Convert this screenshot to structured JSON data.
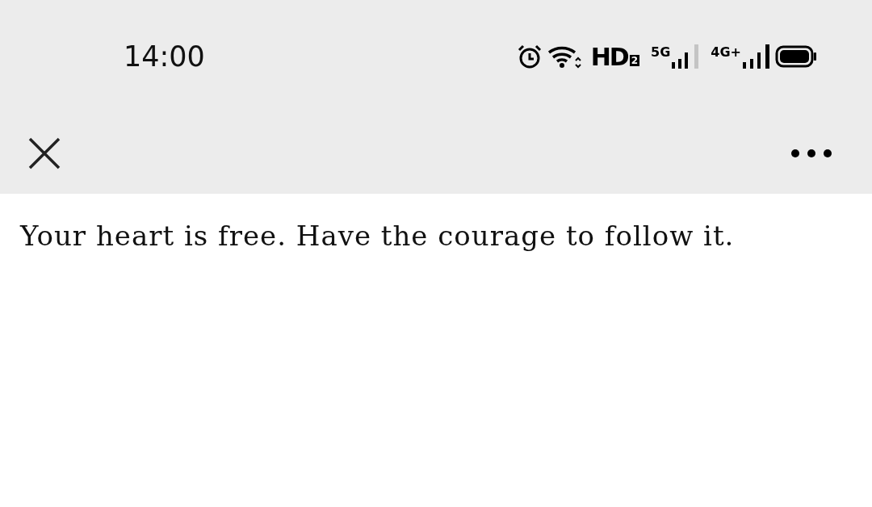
{
  "status_bar": {
    "time": "14:00",
    "hd_label": "HD",
    "hd_badge": "2",
    "network_1": "5G",
    "network_2": "4G+"
  },
  "message": "Your heart is free. Have the courage to follow it."
}
